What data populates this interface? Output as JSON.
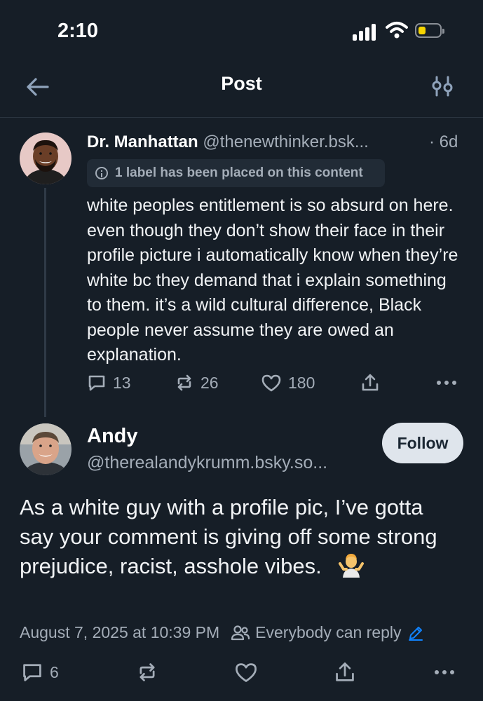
{
  "status_bar": {
    "time": "2:10"
  },
  "header": {
    "title": "Post"
  },
  "parent_post": {
    "display_name": "Dr. Manhattan",
    "handle": "@thenewthinker.bsk...",
    "timestamp": "· 6d",
    "label_notice": "1 label has been placed on this content",
    "text": "white peoples entitlement is so absurd on here. even though they don’t show their face in their profile picture i automatically know when they’re white bc they demand that i explain something to them. it’s a wild cultural difference, Black people never assume they are owed an explanation.",
    "reply_count": "13",
    "repost_count": "26",
    "like_count": "180"
  },
  "reply_post": {
    "display_name": "Andy",
    "handle": "@therealandykrumm.bsky.so...",
    "follow_label": "Follow",
    "text": "As a white guy with a profile pic, I’ve gotta say your comment is giving off some strong prejudice, racist, asshole vibes.",
    "date": "August 7, 2025 at 10:39 PM",
    "reply_setting": "Everybody can reply",
    "reply_count": "6"
  },
  "colors": {
    "background": "#161e27",
    "secondary_text": "#a4adb8",
    "accent": "#1083fe",
    "follow_bg": "#dfe5ec"
  },
  "icons": [
    "back-arrow-icon",
    "filter-icon",
    "info-icon",
    "comment-icon",
    "repost-icon",
    "heart-icon",
    "share-icon",
    "more-icon",
    "people-icon",
    "pencil-icon",
    "shrug-emoji"
  ]
}
